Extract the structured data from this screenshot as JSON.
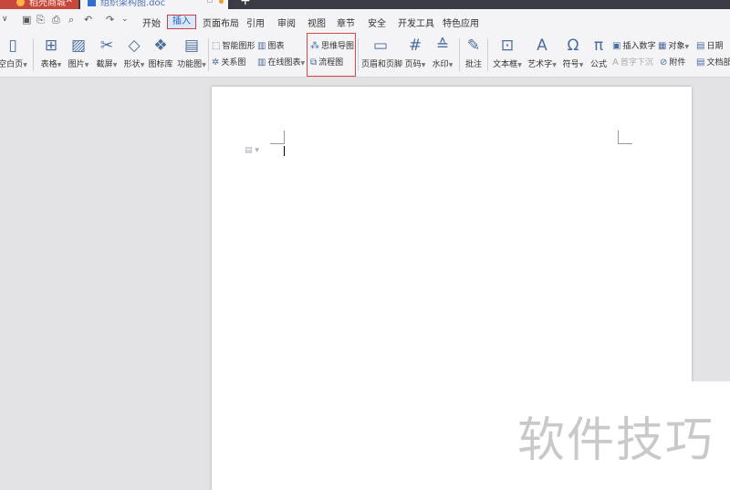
{
  "tabs": {
    "shop_title": "稻壳商城",
    "doc_title": "组织架构图.doc",
    "new_tab": "+"
  },
  "menu": {
    "items": [
      "开始",
      "插入",
      "页面布局",
      "引用",
      "审阅",
      "视图",
      "章节",
      "安全",
      "开发工具",
      "特色应用"
    ],
    "active": "插入"
  },
  "ribbon": {
    "blank_page": "空白页",
    "table": "表格",
    "picture": "图片",
    "screenshot": "截屏",
    "shape": "形状",
    "icon_lib": "图标库",
    "function_chart": "功能图",
    "smart_art": "智能图形",
    "relation_chart": "关系图",
    "chart": "图表",
    "online_chart": "在线图表",
    "mind_map": "思维导图",
    "flowchart": "流程图",
    "header_footer": "页眉和页脚",
    "page_number": "页码",
    "watermark": "水印",
    "comment": "批注",
    "text_box": "文本框",
    "word_art": "艺术字",
    "symbol": "符号",
    "formula": "公式",
    "insert_number": "插入数字",
    "drop_cap": "首字下沉",
    "object": "对象",
    "attachment": "附件",
    "date": "日期",
    "doc_part": "文档部"
  },
  "overlay": {
    "watermark_text": "软件技巧"
  }
}
